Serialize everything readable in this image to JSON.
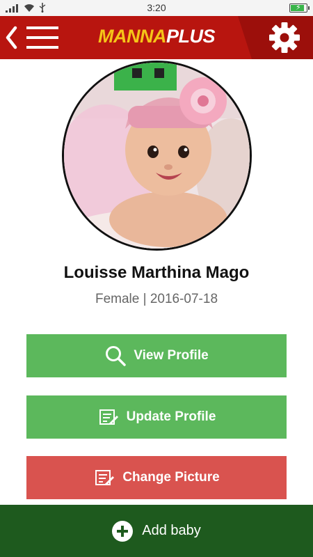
{
  "status_bar": {
    "time": "3:20",
    "battery_level": 0.9,
    "charging": true
  },
  "header": {
    "logo_part1": "MANNA",
    "logo_part2": "PLUS",
    "icons": [
      "back-icon",
      "menu-icon",
      "gear-icon"
    ]
  },
  "profile": {
    "name": "Louisse Marthina Mago",
    "details": "Female | 2016-07-18"
  },
  "actions": {
    "view_profile": "View Profile",
    "update_profile": "Update Profile",
    "change_picture": "Change Picture"
  },
  "bottom_bar": {
    "add_baby": "Add baby"
  },
  "colors": {
    "header_red": "#b8150f",
    "logo_yellow": "#f5c518",
    "button_green": "#5cb85c",
    "button_red": "#d9534f",
    "bottom_green": "#1e5a1e"
  }
}
